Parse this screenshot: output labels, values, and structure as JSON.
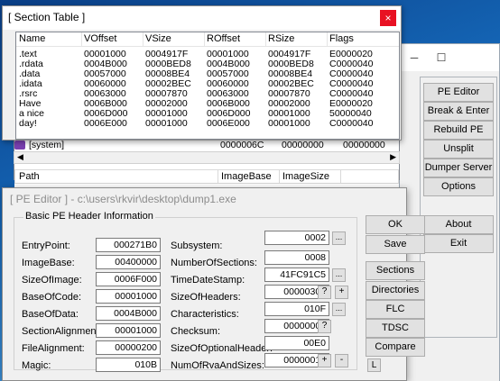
{
  "section_table": {
    "title": "[ Section Table ]",
    "close_glyph": "×",
    "columns": [
      "Name",
      "VOffset",
      "VSize",
      "ROffset",
      "RSize",
      "Flags"
    ],
    "rows": [
      [
        ".text",
        "00001000",
        "0004917F",
        "00001000",
        "0004917F",
        "E0000020"
      ],
      [
        ".rdata",
        "0004B000",
        "0000BED8",
        "0004B000",
        "0000BED8",
        "C0000040"
      ],
      [
        ".data",
        "00057000",
        "00008BE4",
        "00057000",
        "00008BE4",
        "C0000040"
      ],
      [
        ".idata",
        "00060000",
        "00002BEC",
        "00060000",
        "00002BEC",
        "C0000040"
      ],
      [
        ".rsrc",
        "00063000",
        "00007870",
        "00063000",
        "00007870",
        "C0000040"
      ],
      [
        "Have",
        "0006B000",
        "00002000",
        "0006B000",
        "00002000",
        "E0000020"
      ],
      [
        "a nice",
        "0006D000",
        "00001000",
        "0006D000",
        "00001000",
        "50000040"
      ],
      [
        "day!",
        "0006E000",
        "00001000",
        "0006E000",
        "00001000",
        "C0000040"
      ]
    ]
  },
  "background": {
    "process_row": {
      "name": "[system]",
      "col2": "0000006C",
      "col3": "00000000",
      "col4": "00000000"
    },
    "module_headers": [
      "Path",
      "ImageBase",
      "ImageSize"
    ],
    "side_buttons": [
      "PE Editor",
      "Break & Enter",
      "Rebuild PE",
      "Unsplit",
      "Dumper Server",
      "Options",
      "About",
      "Exit"
    ],
    "window_controls": {
      "minimize": "─",
      "maximize": "☐"
    }
  },
  "pe_editor": {
    "title": "[ PE Editor ] - c:\\users\\rkvir\\desktop\\dump1.exe",
    "group_title": "Basic PE Header Information",
    "left_fields": [
      {
        "label": "EntryPoint:",
        "value": "000271B0"
      },
      {
        "label": "ImageBase:",
        "value": "00400000"
      },
      {
        "label": "SizeOfImage:",
        "value": "0006F000"
      },
      {
        "label": "BaseOfCode:",
        "value": "00001000"
      },
      {
        "label": "BaseOfData:",
        "value": "0004B000"
      },
      {
        "label": "SectionAlignment:",
        "value": "00001000"
      },
      {
        "label": "FileAlignment:",
        "value": "00000200"
      },
      {
        "label": "Magic:",
        "value": "010B"
      }
    ],
    "right_fields": [
      {
        "label": "Subsystem:",
        "value": "0002"
      },
      {
        "label": "NumberOfSections:",
        "value": "0008"
      },
      {
        "label": "TimeDateStamp:",
        "value": "41FC91C5"
      },
      {
        "label": "SizeOfHeaders:",
        "value": "00000300"
      },
      {
        "label": "Characteristics:",
        "value": "010F"
      },
      {
        "label": "Checksum:",
        "value": "00000000"
      },
      {
        "label": "SizeOfOptionalHeader:",
        "value": "00E0"
      },
      {
        "label": "NumOfRvaAndSizes:",
        "value": "00000010"
      }
    ],
    "buttons": {
      "ok": "OK",
      "save": "Save",
      "sections": "Sections",
      "directories": "Directories",
      "flc": "FLC",
      "tdsc": "TDSC",
      "compare": "Compare",
      "l": "L"
    },
    "small": {
      "dots": "...",
      "question": "?",
      "plus": "+",
      "minus": "-"
    }
  }
}
